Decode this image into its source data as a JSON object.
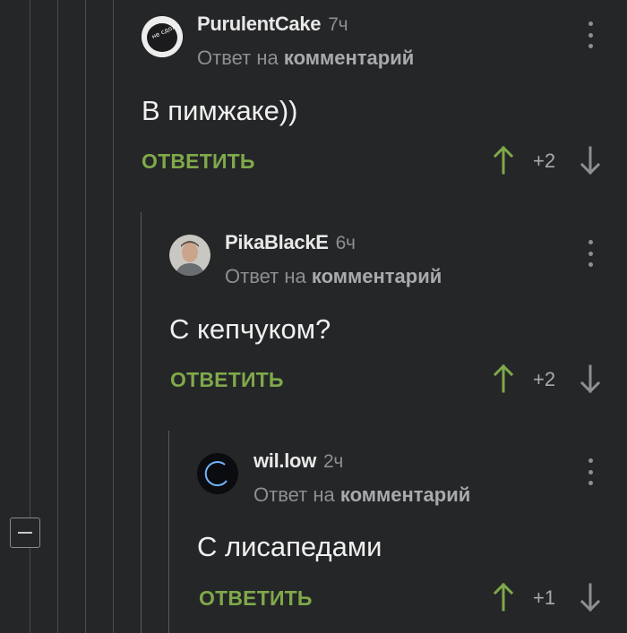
{
  "comments": [
    {
      "username": "PurulentCake",
      "time": "7ч",
      "reply_prefix": "Ответ на",
      "reply_target": "комментарий",
      "text": "В пимжаке))",
      "reply_label": "ОТВЕТИТЬ",
      "score": "+2",
      "avatar_caption": "не сдох и ладно"
    },
    {
      "username": "PikaBlackE",
      "time": "6ч",
      "reply_prefix": "Ответ на",
      "reply_target": "комментарий",
      "text": "С кепчуком?",
      "reply_label": "ОТВЕТИТЬ",
      "score": "+2"
    },
    {
      "username": "wil.low",
      "time": "2ч",
      "reply_prefix": "Ответ на",
      "reply_target": "комментарий",
      "text": "С лисапедами",
      "reply_label": "ОТВЕТИТЬ",
      "score": "+1"
    }
  ],
  "colors": {
    "background": "#252628",
    "accent_green": "#7fa94a",
    "muted": "#8e8f92"
  },
  "icons": {
    "menu": "more-vert-icon",
    "upvote": "arrow-up-icon",
    "downvote": "arrow-down-icon",
    "collapse": "minus-box-icon"
  }
}
